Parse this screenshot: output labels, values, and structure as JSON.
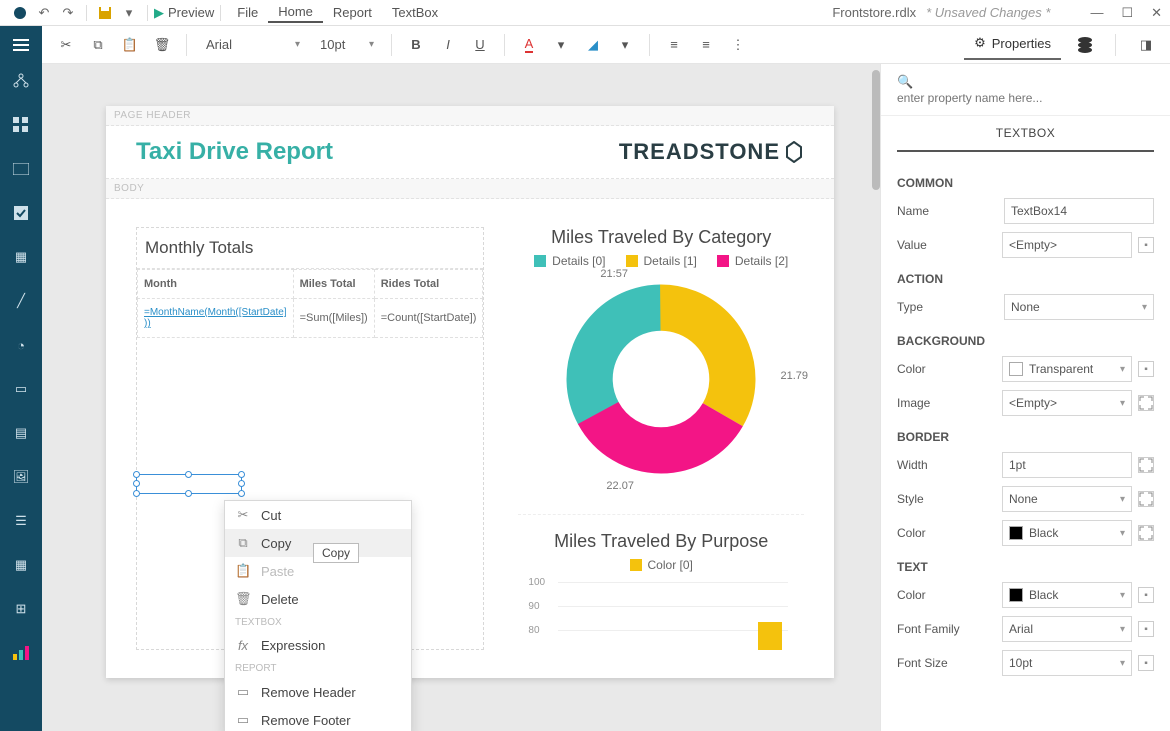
{
  "titlebar": {
    "preview": "Preview",
    "menu": [
      "File",
      "Home",
      "Report",
      "TextBox"
    ],
    "active_menu_idx": 1,
    "filename": "Frontstore.rdlx",
    "dirty": "* Unsaved Changes *"
  },
  "toolbar": {
    "font_family": "Arial",
    "font_size": "10pt",
    "properties_tab": "Properties"
  },
  "report": {
    "page_header_label": "PAGE HEADER",
    "body_label": "BODY",
    "title": "Taxi Drive Report",
    "brand": "TREADSTONE",
    "monthly": {
      "heading": "Monthly Totals",
      "cols": [
        "Month",
        "Miles Total",
        "Rides Total"
      ],
      "exprs": [
        "=MonthName(Month([StartDate] ))",
        "=Sum([Miles])",
        "=Count([StartDate])"
      ]
    },
    "donut": {
      "title": "Miles Traveled By Category",
      "legend": [
        "Details [0]",
        "Details [1]",
        "Details [2]"
      ],
      "labels": [
        "21:57",
        "21.79",
        "22.07"
      ]
    },
    "bar": {
      "title": "Miles Traveled By Purpose",
      "legend": [
        "Color [0]"
      ],
      "yticks": [
        "100",
        "90",
        "80"
      ]
    }
  },
  "chart_data": [
    {
      "type": "pie",
      "title": "Miles Traveled By Category",
      "series": [
        {
          "name": "Details [0]",
          "value": 21.57,
          "color": "#3fc0b8"
        },
        {
          "name": "Details [1]",
          "value": 21.79,
          "color": "#f4c20d"
        },
        {
          "name": "Details [2]",
          "value": 22.07,
          "color": "#f31586"
        }
      ]
    },
    {
      "type": "bar",
      "title": "Miles Traveled By Purpose",
      "categories": [
        "Color [0]"
      ],
      "values": [
        80
      ],
      "ylim": [
        80,
        100
      ],
      "yticks": [
        100,
        90,
        80
      ],
      "series_color": "#f4c20d"
    }
  ],
  "contextmenu": {
    "items": [
      "Cut",
      "Copy",
      "Paste",
      "Delete"
    ],
    "group_textbox": "TEXTBOX",
    "item_expression": "Expression",
    "group_report": "REPORT",
    "item_remove_header": "Remove Header",
    "item_remove_footer": "Remove Footer",
    "tooltip": "Copy"
  },
  "search_placeholder": "enter property name here...",
  "props": {
    "heading": "TEXTBOX",
    "common_label": "COMMON",
    "name_label": "Name",
    "name_value": "TextBox14",
    "value_label": "Value",
    "value_value": "<Empty>",
    "action_label": "ACTION",
    "type_label": "Type",
    "type_value": "None",
    "background_label": "BACKGROUND",
    "bg_color_label": "Color",
    "bg_color_value": "Transparent",
    "bg_image_label": "Image",
    "bg_image_value": "<Empty>",
    "border_label": "BORDER",
    "border_width_label": "Width",
    "border_width_value": "1pt",
    "border_style_label": "Style",
    "border_style_value": "None",
    "border_color_label": "Color",
    "border_color_value": "Black",
    "text_label": "TEXT",
    "text_color_label": "Color",
    "text_color_value": "Black",
    "font_family_label": "Font Family",
    "font_family_value": "Arial",
    "font_size_label": "Font Size",
    "font_size_value": "10pt"
  },
  "colors": {
    "teal": "#3fc0b8",
    "yellow": "#f4c20d",
    "magenta": "#f31586",
    "black": "#000000"
  }
}
